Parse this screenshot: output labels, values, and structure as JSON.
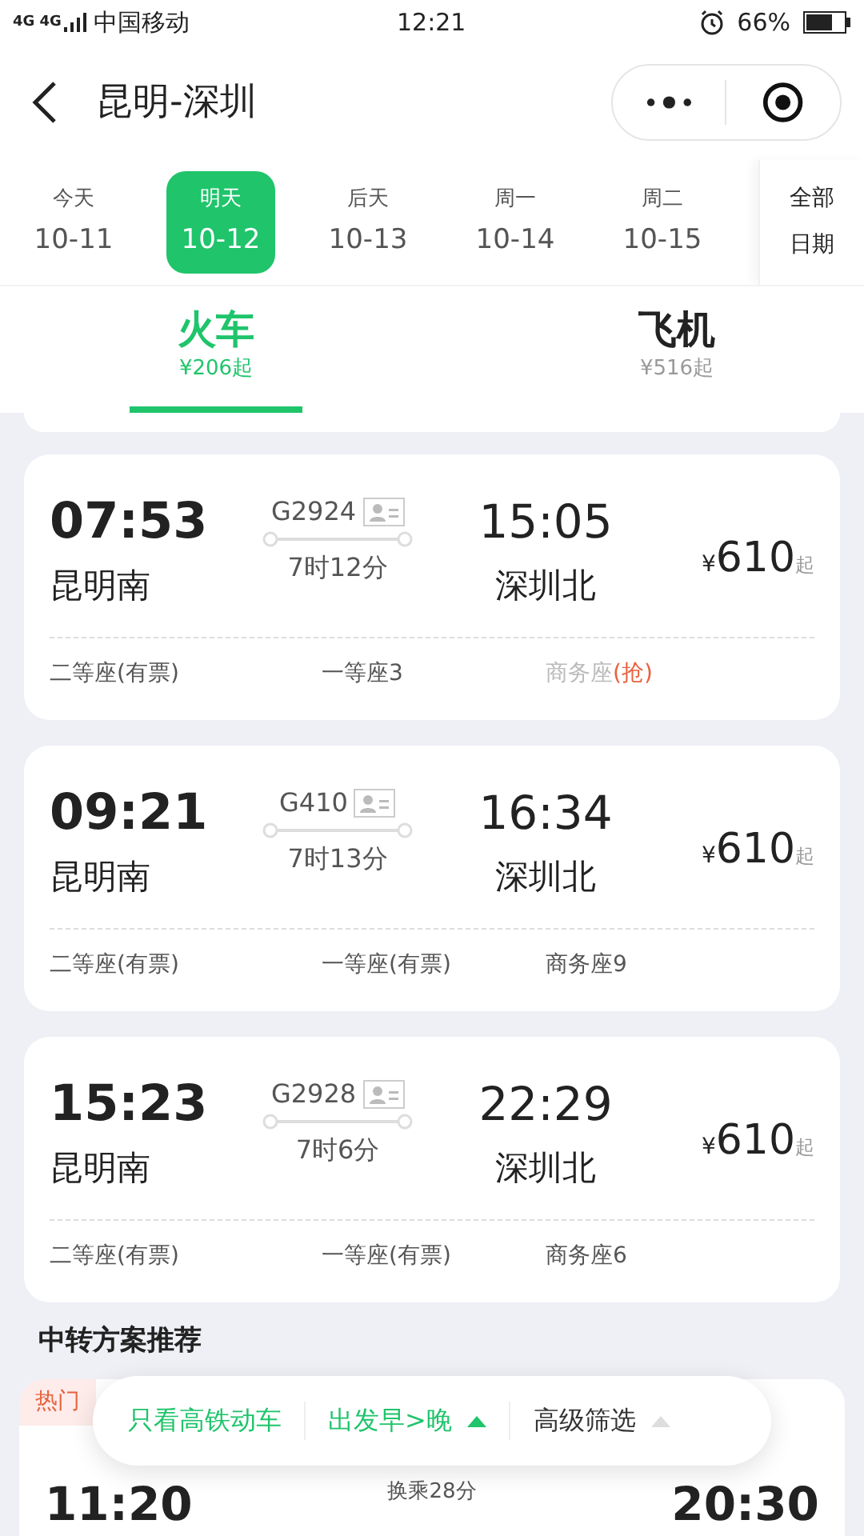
{
  "status_bar": {
    "network": "4G 4G",
    "carrier": "中国移动",
    "time": "12:21",
    "battery": "66%"
  },
  "header": {
    "title": "昆明-深圳"
  },
  "dates": [
    {
      "day": "今天",
      "date": "10-11",
      "selected": false
    },
    {
      "day": "明天",
      "date": "10-12",
      "selected": true
    },
    {
      "day": "后天",
      "date": "10-13",
      "selected": false
    },
    {
      "day": "周一",
      "date": "10-14",
      "selected": false
    },
    {
      "day": "周二",
      "date": "10-15",
      "selected": false
    }
  ],
  "all_dates": [
    "全部",
    "日期"
  ],
  "tabs": [
    {
      "label": "火车",
      "price": "¥206起",
      "selected": true
    },
    {
      "label": "飞机",
      "price": "¥516起",
      "selected": false
    }
  ],
  "trains": [
    {
      "depart_time": "07:53",
      "depart_station": "昆明南",
      "number": "G2924",
      "duration": "7时12分",
      "arrive_time": "15:05",
      "arrive_station": "深圳北",
      "currency": "¥",
      "price": "610",
      "suffix": "起",
      "seats": [
        {
          "label": "二等座(有票)",
          "sold_out": false
        },
        {
          "label": "一等座3",
          "sold_out": false
        },
        {
          "label": "商务座",
          "note": "(抢)",
          "sold_out": true
        }
      ]
    },
    {
      "depart_time": "09:21",
      "depart_station": "昆明南",
      "number": "G410",
      "duration": "7时13分",
      "arrive_time": "16:34",
      "arrive_station": "深圳北",
      "currency": "¥",
      "price": "610",
      "suffix": "起",
      "seats": [
        {
          "label": "二等座(有票)",
          "sold_out": false
        },
        {
          "label": "一等座(有票)",
          "sold_out": false
        },
        {
          "label": "商务座9",
          "sold_out": false
        }
      ]
    },
    {
      "depart_time": "15:23",
      "depart_station": "昆明南",
      "number": "G2928",
      "duration": "7时6分",
      "arrive_time": "22:29",
      "arrive_station": "深圳北",
      "currency": "¥",
      "price": "610",
      "suffix": "起",
      "seats": [
        {
          "label": "二等座(有票)",
          "sold_out": false
        },
        {
          "label": "一等座(有票)",
          "sold_out": false
        },
        {
          "label": "商务座6",
          "sold_out": false
        }
      ]
    }
  ],
  "transfer": {
    "heading": "中转方案推荐",
    "tag": "热门",
    "depart_time": "11:20",
    "transfer_time": "换乘28分",
    "arrive_time": "20:30"
  },
  "filters": [
    {
      "label": "只看高铁动车",
      "kind": "toggle",
      "active": true
    },
    {
      "label": "出发早>晚",
      "kind": "sort",
      "active": true
    },
    {
      "label": "高级筛选",
      "kind": "sort",
      "active": false
    }
  ]
}
